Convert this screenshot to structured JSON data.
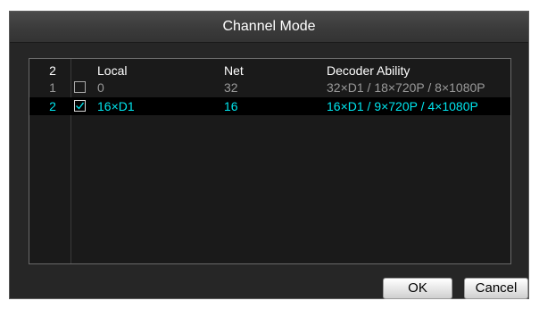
{
  "dialog": {
    "title": "Channel Mode"
  },
  "table": {
    "header": {
      "index": "2",
      "local": "Local",
      "net": "Net",
      "decoder": "Decoder Ability"
    },
    "rows": [
      {
        "index": "1",
        "checked": false,
        "local": "0",
        "net": "32",
        "decoder": "32×D1 / 18×720P /  8×1080P"
      },
      {
        "index": "2",
        "checked": true,
        "local": "16×D1",
        "net": "16",
        "decoder": "16×D1 /  9×720P /  4×1080P"
      }
    ]
  },
  "buttons": {
    "ok": "OK",
    "cancel": "Cancel"
  },
  "colors": {
    "selected_text": "#00e5ee",
    "unselected_text": "#9a9a9a",
    "dialog_bg": "#262626"
  }
}
